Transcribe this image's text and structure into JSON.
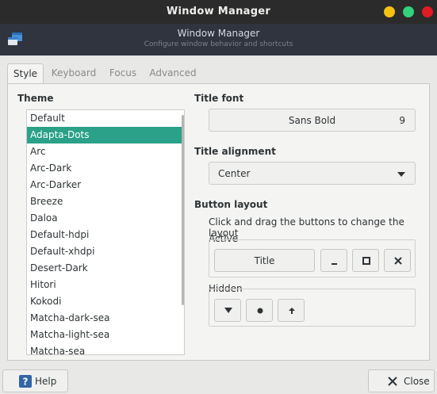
{
  "window": {
    "title": "Window Manager"
  },
  "header": {
    "title": "Window Manager",
    "subtitle": "Configure window behavior and shortcuts"
  },
  "tabs": [
    {
      "label": "Style",
      "active": true
    },
    {
      "label": "Keyboard",
      "active": false
    },
    {
      "label": "Focus",
      "active": false
    },
    {
      "label": "Advanced",
      "active": false
    }
  ],
  "style": {
    "theme_label": "Theme",
    "themes": [
      "Default",
      "Adapta-Dots",
      "Arc",
      "Arc-Dark",
      "Arc-Darker",
      "Breeze",
      "Daloa",
      "Default-hdpi",
      "Default-xhdpi",
      "Desert-Dark",
      "Hitori",
      "Kokodi",
      "Matcha-dark-sea",
      "Matcha-light-sea",
      "Matcha-sea"
    ],
    "selected_theme": "Adapta-Dots",
    "title_font_label": "Title font",
    "title_font_name": "Sans Bold",
    "title_font_size": "9",
    "title_alignment_label": "Title alignment",
    "title_alignment_value": "Center",
    "button_layout_label": "Button layout",
    "button_layout_hint": "Click and drag the buttons to change the layout",
    "active_label": "Active",
    "active_title_button": "Title",
    "hidden_label": "Hidden"
  },
  "footer": {
    "help_label": "Help",
    "close_label": "Close"
  },
  "colors": {
    "selection": "#2aa188",
    "header_bg": "#2f343f",
    "titlebar_bg": "#2b2b2b"
  }
}
